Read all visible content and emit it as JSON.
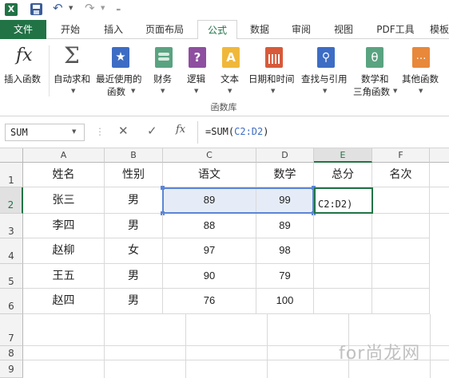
{
  "colors": {
    "accent": "#217346",
    "ref": "#3d6cc4"
  },
  "qat": {
    "icons": [
      "excel-icon",
      "save-icon",
      "undo-icon",
      "redo-icon",
      "customize-icon"
    ]
  },
  "tabs": [
    "文件",
    "开始",
    "插入",
    "页面布局",
    "公式",
    "数据",
    "审阅",
    "视图",
    "PDF工具",
    "模板"
  ],
  "active_tab": "公式",
  "ribbon": {
    "insert_fn": "插入函数",
    "autosum": "自动求和",
    "recent_1": "最近使用的",
    "recent_2": "函数",
    "finance": "财务",
    "logic": "逻辑",
    "text": "文本",
    "datetime": "日期和时间",
    "lookup": "查找与引用",
    "math_1": "数学和",
    "math_2": "三角函数",
    "other": "其他函数",
    "group": "函数库"
  },
  "formula_bar": {
    "name_box": "SUM",
    "fx": "fx",
    "prefix": "=SUM(",
    "ref": "C2:D2",
    "suffix": ")"
  },
  "columns": [
    "A",
    "B",
    "C",
    "D",
    "E",
    "F"
  ],
  "rows": [
    "1",
    "2",
    "3",
    "4",
    "5",
    "6",
    "7",
    "8",
    "9"
  ],
  "headers": [
    "姓名",
    "性别",
    "语文",
    "数学",
    "总分",
    "名次"
  ],
  "data": [
    [
      "张三",
      "男",
      "89",
      "99"
    ],
    [
      "李四",
      "男",
      "88",
      "89"
    ],
    [
      "赵柳",
      "女",
      "97",
      "98"
    ],
    [
      "王五",
      "男",
      "90",
      "79"
    ],
    [
      "赵四",
      "男",
      "76",
      "100"
    ]
  ],
  "editing_text": "C2:D2)",
  "watermark": "for尚龙网"
}
